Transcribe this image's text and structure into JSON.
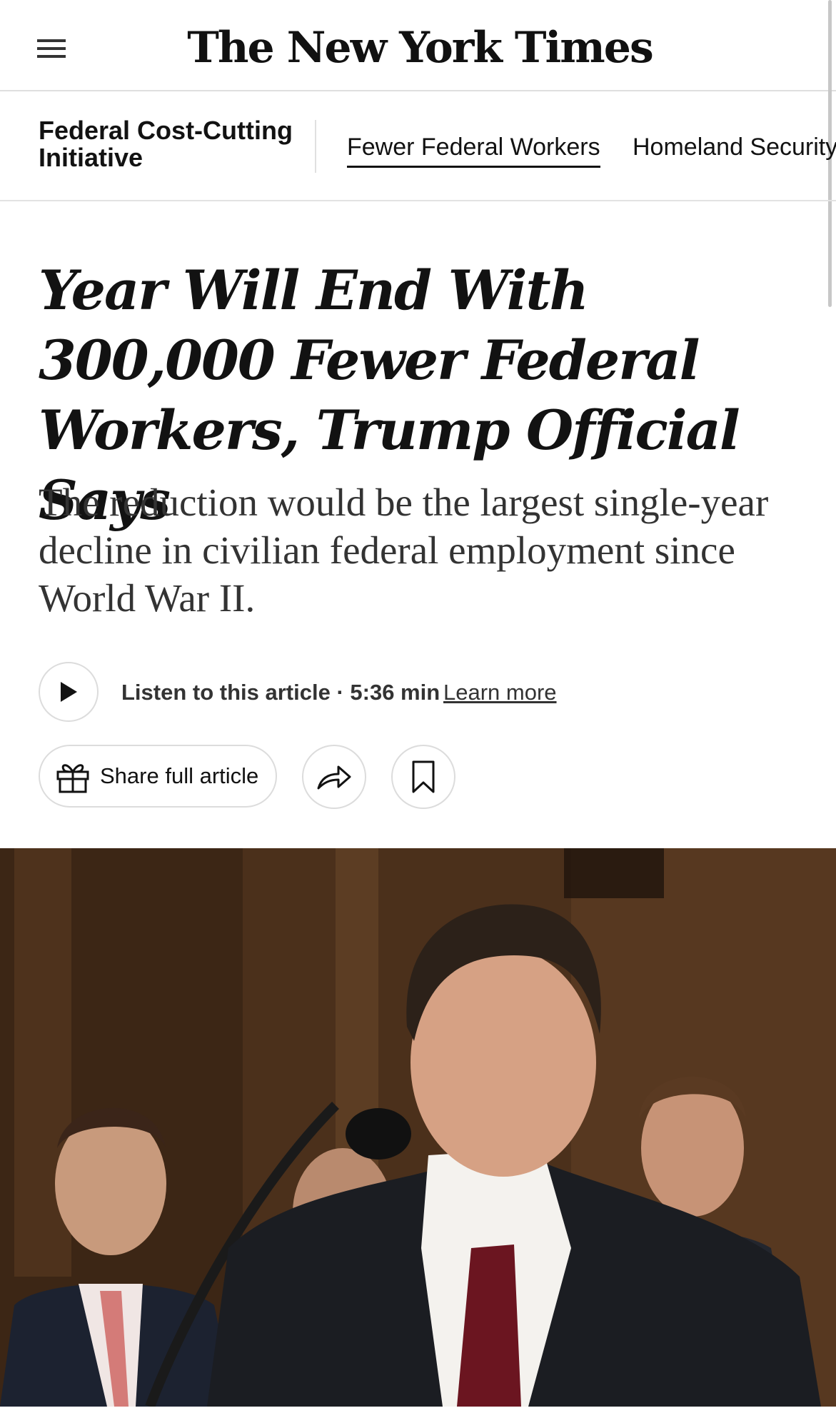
{
  "header": {
    "masthead": "The New York Times"
  },
  "subnav": {
    "section_name": "Federal Cost-Cutting Initiative",
    "tabs": [
      {
        "label": "Fewer Federal Workers",
        "active": true
      },
      {
        "label": "Homeland Security",
        "active": false
      }
    ]
  },
  "article": {
    "headline": "Year Will End With 300,000 Fewer Federal Workers, Trump Official Says",
    "summary": "The reduction would be the largest single-year decline in civilian federal employment since World War II."
  },
  "audio": {
    "listen_label": "Listen to this article · 5:36 min",
    "learn_more": "Learn more"
  },
  "actions": {
    "share_label": "Share full article"
  },
  "icons": {
    "menu": "hamburger-menu-icon",
    "play": "play-icon",
    "gift": "gift-icon",
    "forward": "share-arrow-icon",
    "bookmark": "bookmark-icon"
  }
}
